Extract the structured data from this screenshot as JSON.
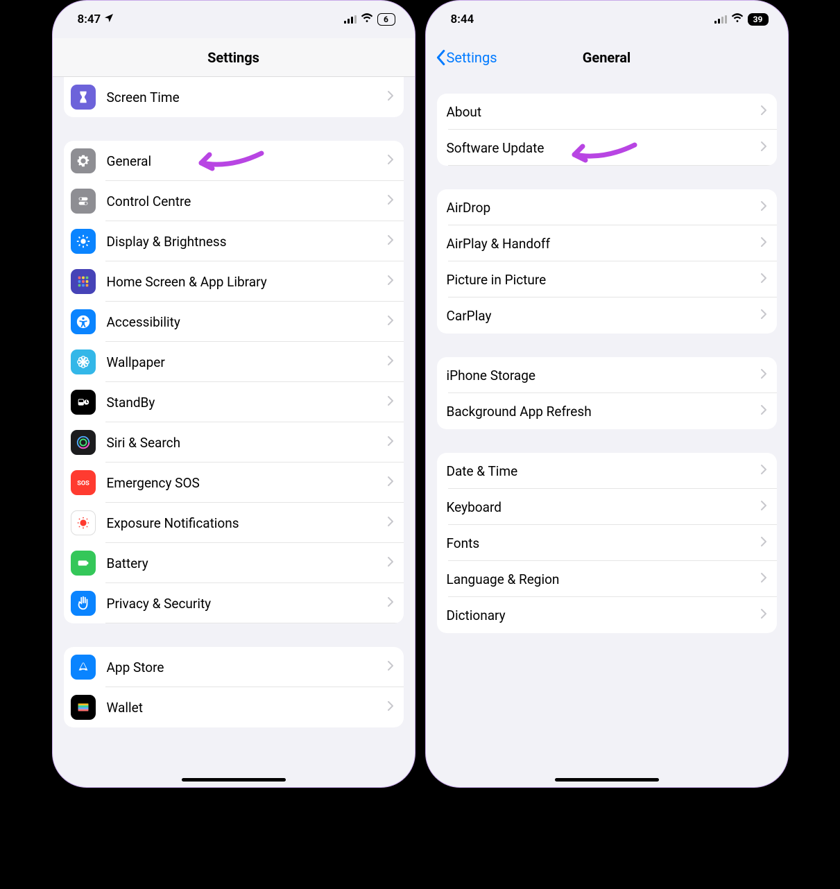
{
  "left": {
    "status": {
      "time": "8:47",
      "location_icon": "location-arrow",
      "battery": "6"
    },
    "header": {
      "title": "Settings"
    },
    "annotation_target": 1,
    "groups": [
      [
        {
          "label": "Screen Time",
          "icon": "hourglass",
          "bg": "#6d63da"
        }
      ],
      [
        {
          "label": "General",
          "icon": "gear",
          "bg": "#8e8e93"
        },
        {
          "label": "Control Centre",
          "icon": "toggles",
          "bg": "#8e8e93"
        },
        {
          "label": "Display & Brightness",
          "icon": "sun",
          "bg": "#0a84ff"
        },
        {
          "label": "Home Screen & App Library",
          "icon": "apps-grid",
          "bg": "#4643b7"
        },
        {
          "label": "Accessibility",
          "icon": "accessibility",
          "bg": "#0a84ff"
        },
        {
          "label": "Wallpaper",
          "icon": "flower",
          "bg": "#33b7e8"
        },
        {
          "label": "StandBy",
          "icon": "standby",
          "bg": "#000000"
        },
        {
          "label": "Siri & Search",
          "icon": "siri",
          "bg": "#1c1c1e"
        },
        {
          "label": "Emergency SOS",
          "icon": "sos",
          "bg": "#ff3b30"
        },
        {
          "label": "Exposure Notifications",
          "icon": "exposure",
          "bg": "#ffffff"
        },
        {
          "label": "Battery",
          "icon": "battery",
          "bg": "#34c759"
        },
        {
          "label": "Privacy & Security",
          "icon": "hand",
          "bg": "#0a84ff"
        }
      ],
      [
        {
          "label": "App Store",
          "icon": "appstore",
          "bg": "#0a84ff"
        },
        {
          "label": "Wallet",
          "icon": "wallet",
          "bg": "#000000"
        }
      ]
    ]
  },
  "right": {
    "status": {
      "time": "8:44",
      "battery": "39"
    },
    "header": {
      "title": "General",
      "back": "Settings"
    },
    "annotation_target": 0,
    "groups": [
      [
        {
          "label": "About"
        },
        {
          "label": "Software Update"
        }
      ],
      [
        {
          "label": "AirDrop"
        },
        {
          "label": "AirPlay & Handoff"
        },
        {
          "label": "Picture in Picture"
        },
        {
          "label": "CarPlay"
        }
      ],
      [
        {
          "label": "iPhone Storage"
        },
        {
          "label": "Background App Refresh"
        }
      ],
      [
        {
          "label": "Date & Time"
        },
        {
          "label": "Keyboard"
        },
        {
          "label": "Fonts"
        },
        {
          "label": "Language & Region"
        },
        {
          "label": "Dictionary"
        }
      ]
    ]
  },
  "colors": {
    "annotation": "#b845e3"
  }
}
